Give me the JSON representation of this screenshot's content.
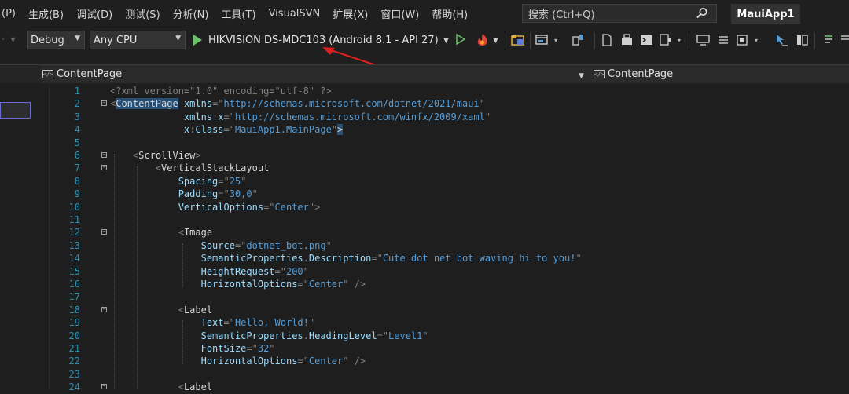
{
  "menu": [
    "(P)",
    "生成(B)",
    "调试(D)",
    "测试(S)",
    "分析(N)",
    "工具(T)",
    "VisualSVN",
    "扩展(X)",
    "窗口(W)",
    "帮助(H)"
  ],
  "search": {
    "placeholder": "搜索 (Ctrl+Q)"
  },
  "app_title": "MauiApp1",
  "toolbar": {
    "config": "Debug",
    "platform": "Any CPU",
    "run_target": "HIKVISION DS-MDC103 (Android 8.1 - API 27)"
  },
  "nav": {
    "left": "ContentPage",
    "right": "ContentPage"
  },
  "icons": {
    "search": "search-icon",
    "play": "play-icon",
    "play_outline": "play-without-debug-icon",
    "hot_reload": "hot-reload-icon",
    "xml": "xml-icon"
  },
  "colors": {
    "accent_arrow": "#e02020",
    "line_number": "#2b91af",
    "delimiter": "#808080",
    "attr": "#9cdcfe",
    "value": "#569cd6",
    "element": "#d7d7d7"
  },
  "code": [
    {
      "n": "1",
      "tokens": [
        [
          "d",
          "<?xml version=\"1.0\" encoding=\"utf-8\" ?>"
        ]
      ]
    },
    {
      "n": "2",
      "fold": "⊟",
      "tokens": [
        [
          "d",
          "<"
        ],
        [
          "sel",
          "ContentPage"
        ],
        [
          "e",
          " "
        ],
        [
          "a",
          "xmlns"
        ],
        [
          "d",
          "=\""
        ],
        [
          "v",
          "http://schemas.microsoft.com/dotnet/2021/maui"
        ],
        [
          "d",
          "\""
        ]
      ]
    },
    {
      "n": "3",
      "tokens": [
        [
          "e",
          "             "
        ],
        [
          "a",
          "xmlns"
        ],
        [
          "d",
          ":"
        ],
        [
          "a",
          "x"
        ],
        [
          "d",
          "=\""
        ],
        [
          "v",
          "http://schemas.microsoft.com/winfx/2009/xaml"
        ],
        [
          "d",
          "\""
        ]
      ]
    },
    {
      "n": "4",
      "tokens": [
        [
          "e",
          "             "
        ],
        [
          "a",
          "x"
        ],
        [
          "d",
          ":"
        ],
        [
          "a",
          "Class"
        ],
        [
          "d",
          "=\""
        ],
        [
          "v",
          "MauiApp1.MainPage"
        ],
        [
          "d",
          "\""
        ],
        [
          "sel",
          ">"
        ]
      ]
    },
    {
      "n": "5",
      "tokens": []
    },
    {
      "n": "6",
      "fold": "⊟",
      "tokens": [
        [
          "e",
          "    "
        ],
        [
          "d",
          "<"
        ],
        [
          "e",
          "ScrollView"
        ],
        [
          "d",
          ">"
        ]
      ]
    },
    {
      "n": "7",
      "fold": "⊟",
      "tokens": [
        [
          "e",
          "        "
        ],
        [
          "d",
          "<"
        ],
        [
          "e",
          "VerticalStackLayout"
        ]
      ]
    },
    {
      "n": "8",
      "tokens": [
        [
          "e",
          "            "
        ],
        [
          "a",
          "Spacing"
        ],
        [
          "d",
          "=\""
        ],
        [
          "v",
          "25"
        ],
        [
          "d",
          "\""
        ]
      ]
    },
    {
      "n": "9",
      "tokens": [
        [
          "e",
          "            "
        ],
        [
          "a",
          "Padding"
        ],
        [
          "d",
          "=\""
        ],
        [
          "v",
          "30,0"
        ],
        [
          "d",
          "\""
        ]
      ]
    },
    {
      "n": "10",
      "tokens": [
        [
          "e",
          "            "
        ],
        [
          "a",
          "VerticalOptions"
        ],
        [
          "d",
          "=\""
        ],
        [
          "v",
          "Center"
        ],
        [
          "d",
          "\">"
        ]
      ]
    },
    {
      "n": "11",
      "tokens": []
    },
    {
      "n": "12",
      "fold": "⊟",
      "tokens": [
        [
          "e",
          "            "
        ],
        [
          "d",
          "<"
        ],
        [
          "e",
          "Image"
        ]
      ]
    },
    {
      "n": "13",
      "tokens": [
        [
          "e",
          "                "
        ],
        [
          "a",
          "Source"
        ],
        [
          "d",
          "=\""
        ],
        [
          "v",
          "dotnet_bot.png"
        ],
        [
          "d",
          "\""
        ]
      ]
    },
    {
      "n": "14",
      "tokens": [
        [
          "e",
          "                "
        ],
        [
          "a",
          "SemanticProperties"
        ],
        [
          "d",
          "."
        ],
        [
          "a",
          "Description"
        ],
        [
          "d",
          "=\""
        ],
        [
          "v",
          "Cute dot net bot waving hi to you!"
        ],
        [
          "d",
          "\""
        ]
      ]
    },
    {
      "n": "15",
      "tokens": [
        [
          "e",
          "                "
        ],
        [
          "a",
          "HeightRequest"
        ],
        [
          "d",
          "=\""
        ],
        [
          "v",
          "200"
        ],
        [
          "d",
          "\""
        ]
      ]
    },
    {
      "n": "16",
      "tokens": [
        [
          "e",
          "                "
        ],
        [
          "a",
          "HorizontalOptions"
        ],
        [
          "d",
          "=\""
        ],
        [
          "v",
          "Center"
        ],
        [
          "d",
          "\" />"
        ]
      ]
    },
    {
      "n": "17",
      "tokens": []
    },
    {
      "n": "18",
      "fold": "⊟",
      "tokens": [
        [
          "e",
          "            "
        ],
        [
          "d",
          "<"
        ],
        [
          "e",
          "Label"
        ]
      ]
    },
    {
      "n": "19",
      "tokens": [
        [
          "e",
          "                "
        ],
        [
          "a",
          "Text"
        ],
        [
          "d",
          "=\""
        ],
        [
          "v",
          "Hello, World!"
        ],
        [
          "d",
          "\""
        ]
      ]
    },
    {
      "n": "20",
      "tokens": [
        [
          "e",
          "                "
        ],
        [
          "a",
          "SemanticProperties"
        ],
        [
          "d",
          "."
        ],
        [
          "a",
          "HeadingLevel"
        ],
        [
          "d",
          "=\""
        ],
        [
          "v",
          "Level1"
        ],
        [
          "d",
          "\""
        ]
      ]
    },
    {
      "n": "21",
      "tokens": [
        [
          "e",
          "                "
        ],
        [
          "a",
          "FontSize"
        ],
        [
          "d",
          "=\""
        ],
        [
          "v",
          "32"
        ],
        [
          "d",
          "\""
        ]
      ]
    },
    {
      "n": "22",
      "tokens": [
        [
          "e",
          "                "
        ],
        [
          "a",
          "HorizontalOptions"
        ],
        [
          "d",
          "=\""
        ],
        [
          "v",
          "Center"
        ],
        [
          "d",
          "\" />"
        ]
      ]
    },
    {
      "n": "23",
      "tokens": []
    },
    {
      "n": "24",
      "fold": "⊟",
      "tokens": [
        [
          "e",
          "            "
        ],
        [
          "d",
          "<"
        ],
        [
          "e",
          "Label"
        ]
      ]
    }
  ]
}
